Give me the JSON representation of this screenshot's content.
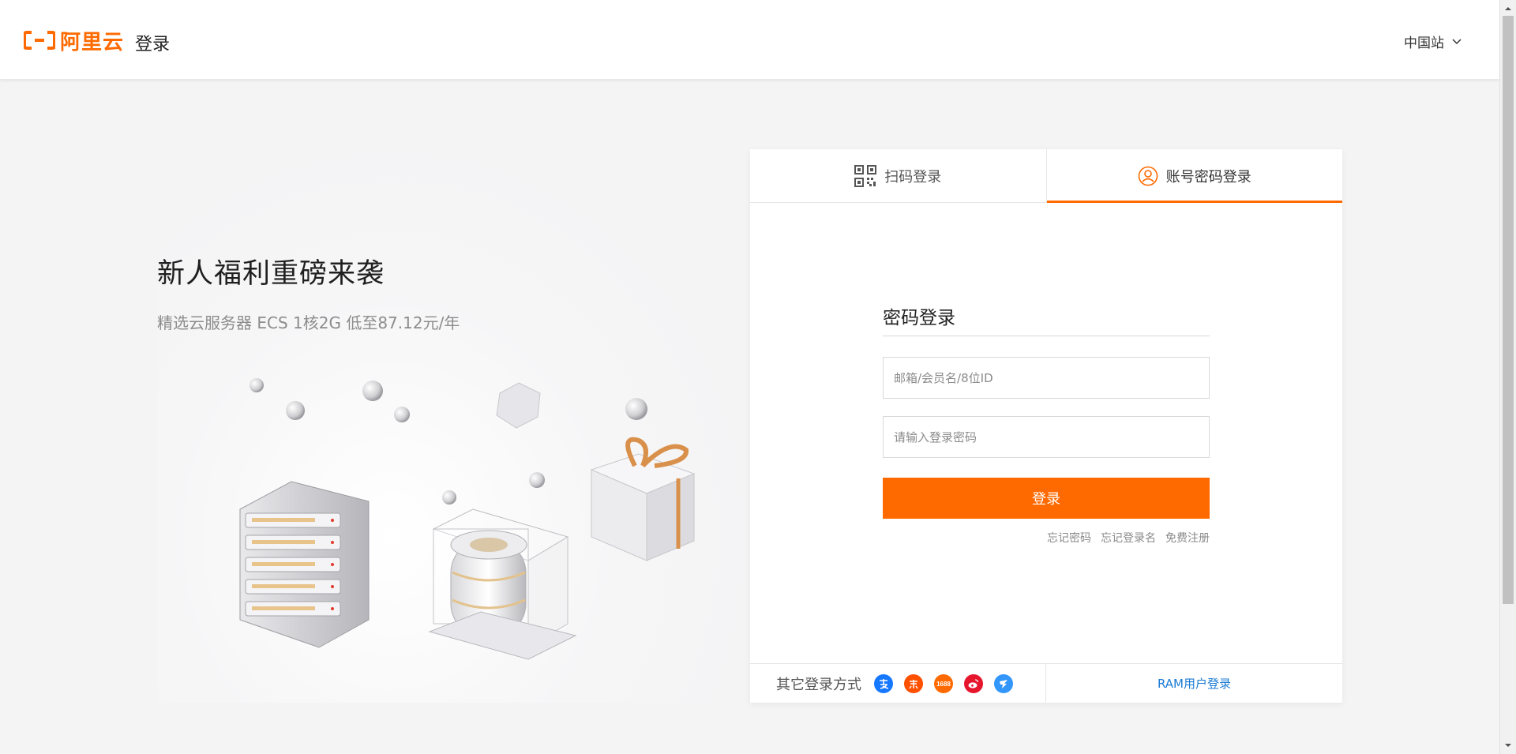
{
  "header": {
    "logo_text": "阿里云",
    "title": "登录",
    "region": "中国站"
  },
  "promo": {
    "title": "新人福利重磅来袭",
    "subtitle": "精选云服务器 ECS 1核2G 低至87.12元/年"
  },
  "tabs": [
    {
      "label": "扫码登录",
      "icon": "qr-code-icon",
      "active": false
    },
    {
      "label": "账号密码登录",
      "icon": "user-circle-icon",
      "active": true
    }
  ],
  "login_form": {
    "title": "密码登录",
    "account_placeholder": "邮箱/会员名/8位ID",
    "password_placeholder": "请输入登录密码",
    "submit_label": "登录",
    "links": {
      "forgot_password": "忘记密码",
      "forgot_username": "忘记登录名",
      "register": "免费注册"
    }
  },
  "footer": {
    "other_methods_label": "其它登录方式",
    "social": [
      {
        "name": "alipay-icon",
        "glyph": "支",
        "color": "#1677ff"
      },
      {
        "name": "taobao-icon",
        "glyph": "淘",
        "color": "#ff5000"
      },
      {
        "name": "1688-icon",
        "glyph": "1688",
        "color": "#ff6a00"
      },
      {
        "name": "weibo-icon",
        "glyph": "微",
        "color": "#e6162d"
      },
      {
        "name": "dingtalk-icon",
        "glyph": "钉",
        "color": "#3296fa"
      }
    ],
    "ram_login": "RAM用户登录"
  },
  "colors": {
    "brand": "#ff6a00",
    "link": "#1b7bd3"
  }
}
